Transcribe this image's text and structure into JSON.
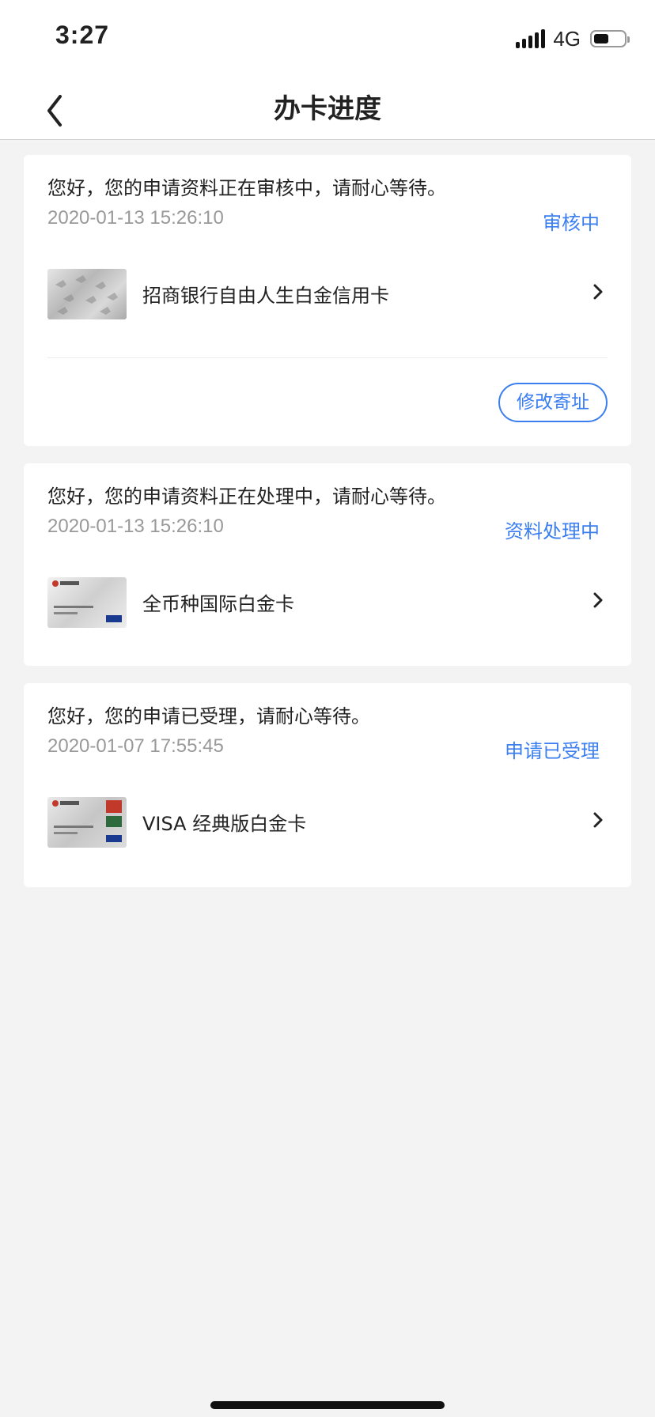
{
  "status_bar": {
    "time": "3:27",
    "network": "4G"
  },
  "nav": {
    "title": "办卡进度"
  },
  "applications": [
    {
      "message": "您好，您的申请资料正在审核中，请耐心等待。",
      "timestamp": "2020-01-13 15:26:10",
      "status": "审核中",
      "card_name": "招商银行自由人生白金信用卡",
      "action_label": "修改寄址"
    },
    {
      "message": "您好，您的申请资料正在处理中，请耐心等待。",
      "timestamp": "2020-01-13 15:26:10",
      "status": "资料处理中",
      "card_name": "全币种国际白金卡"
    },
    {
      "message": "您好，您的申请已受理，请耐心等待。",
      "timestamp": "2020-01-07 17:55:45",
      "status": "申请已受理",
      "card_name": "VISA 经典版白金卡"
    }
  ],
  "colors": {
    "accent": "#3a7ef0",
    "background": "#f3f3f4"
  }
}
